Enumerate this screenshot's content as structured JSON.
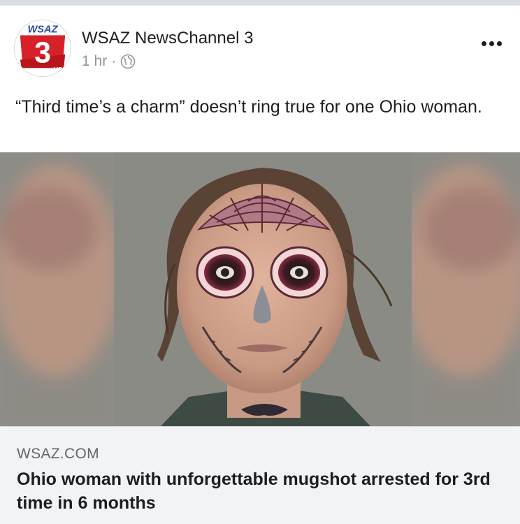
{
  "post": {
    "page_name": "WSAZ NewsChannel 3",
    "time": "1 hr",
    "separator": "·",
    "privacy_icon": "globe-icon",
    "message": "“Third time’s a charm” doesn’t ring true for one Ohio woman.",
    "more_icon": "more-dots-icon"
  },
  "avatar": {
    "logo_text": "WSAZ",
    "logo_number": "3",
    "logo_small": "HD",
    "brand_red": "#d62128"
  },
  "link_card": {
    "domain": "WSAZ.COM",
    "title": "Ohio woman with unforgettable mugshot arrested for 3rd time in 6 months"
  },
  "colors": {
    "name": "#1c1e21",
    "meta": "#90949c",
    "card_bg": "#f2f3f5",
    "card_domain": "#606770"
  }
}
